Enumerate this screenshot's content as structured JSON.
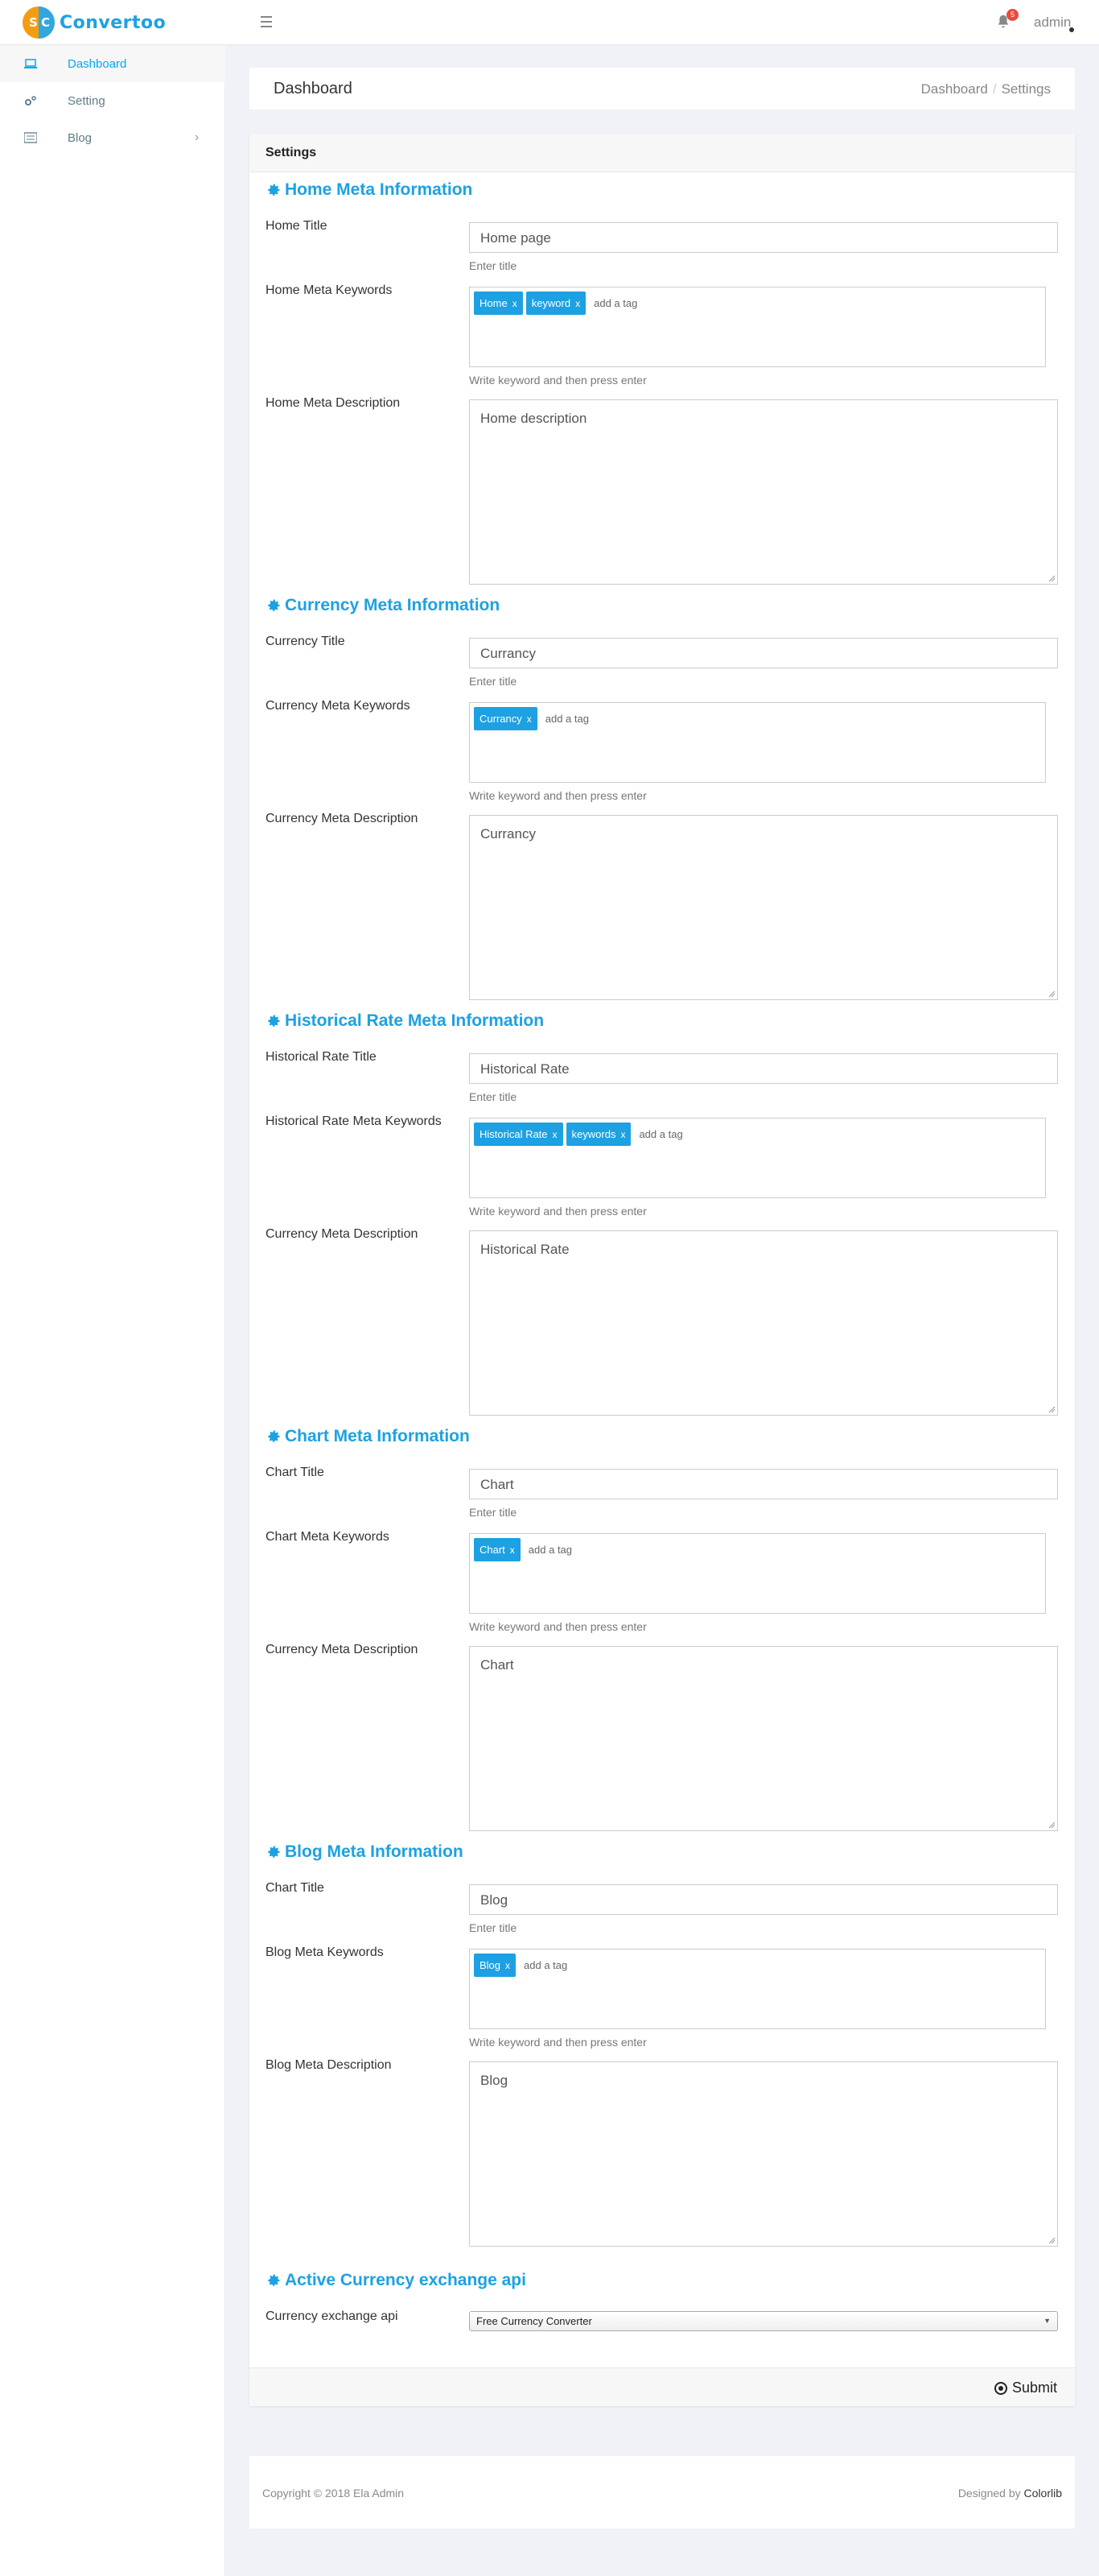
{
  "brand": {
    "logo_letters_1": "S",
    "logo_letters_2": "C",
    "name": "Convertoo"
  },
  "topbar": {
    "notifications_count": "5",
    "user": "admin"
  },
  "sidebar": {
    "items": [
      {
        "label": "Dashboard",
        "icon": "laptop-icon",
        "active": true
      },
      {
        "label": "Setting",
        "icon": "cogs-icon",
        "active": false
      },
      {
        "label": "Blog",
        "icon": "list-icon",
        "active": false
      }
    ]
  },
  "header": {
    "title": "Dashboard",
    "breadcrumb": [
      "Dashboard",
      "Settings"
    ]
  },
  "card": {
    "title": "Settings",
    "submit_label": "Submit"
  },
  "sections": [
    {
      "title": "Home Meta Information",
      "title_label": "Home Title",
      "title_value": "Home page",
      "title_help": "Enter title",
      "keywords_label": "Home Meta Keywords",
      "tags": [
        "Home",
        "keyword"
      ],
      "add_tag": "add a tag",
      "keywords_help": "Write keyword and then press enter",
      "desc_label": "Home Meta Description",
      "desc_value": "Home description"
    },
    {
      "title": "Currency Meta Information",
      "title_label": "Currency Title",
      "title_value": "Currancy",
      "title_help": "Enter title",
      "keywords_label": "Currency Meta Keywords",
      "tags": [
        "Currancy"
      ],
      "add_tag": "add a tag",
      "keywords_help": "Write keyword and then press enter",
      "desc_label": "Currency Meta Description",
      "desc_value": "Currancy"
    },
    {
      "title": "Historical Rate Meta Information",
      "title_label": "Historical Rate Title",
      "title_value": "Historical Rate",
      "title_help": "Enter title",
      "keywords_label": "Historical Rate Meta Keywords",
      "tags": [
        "Historical Rate",
        "keywords"
      ],
      "add_tag": "add a tag",
      "keywords_help": "Write keyword and then press enter",
      "desc_label": "Currency Meta Description",
      "desc_value": "Historical Rate"
    },
    {
      "title": "Chart Meta Information",
      "title_label": "Chart Title",
      "title_value": "Chart",
      "title_help": "Enter title",
      "keywords_label": "Chart Meta Keywords",
      "tags": [
        "Chart"
      ],
      "add_tag": "add a tag",
      "keywords_help": "Write keyword and then press enter",
      "desc_label": "Currency Meta Description",
      "desc_value": "Chart"
    },
    {
      "title": "Blog Meta Information",
      "title_label": "Chart Title",
      "title_value": "Blog",
      "title_help": "Enter title",
      "keywords_label": "Blog Meta Keywords",
      "tags": [
        "Blog"
      ],
      "add_tag": "add a tag",
      "keywords_help": "Write keyword and then press enter",
      "desc_label": "Blog Meta Description",
      "desc_value": "Blog"
    }
  ],
  "api": {
    "title": "Active Currency exchange api",
    "label": "Currency exchange api",
    "selected": "Free Currency Converter"
  },
  "footer": {
    "copyright": "Copyright © 2018 Ela Admin",
    "designed_prefix": "Designed by",
    "designed_by": "Colorlib"
  },
  "colors": {
    "accent": "#1da1e2",
    "tag": "#1da1e2",
    "badge": "#e74c3c"
  }
}
